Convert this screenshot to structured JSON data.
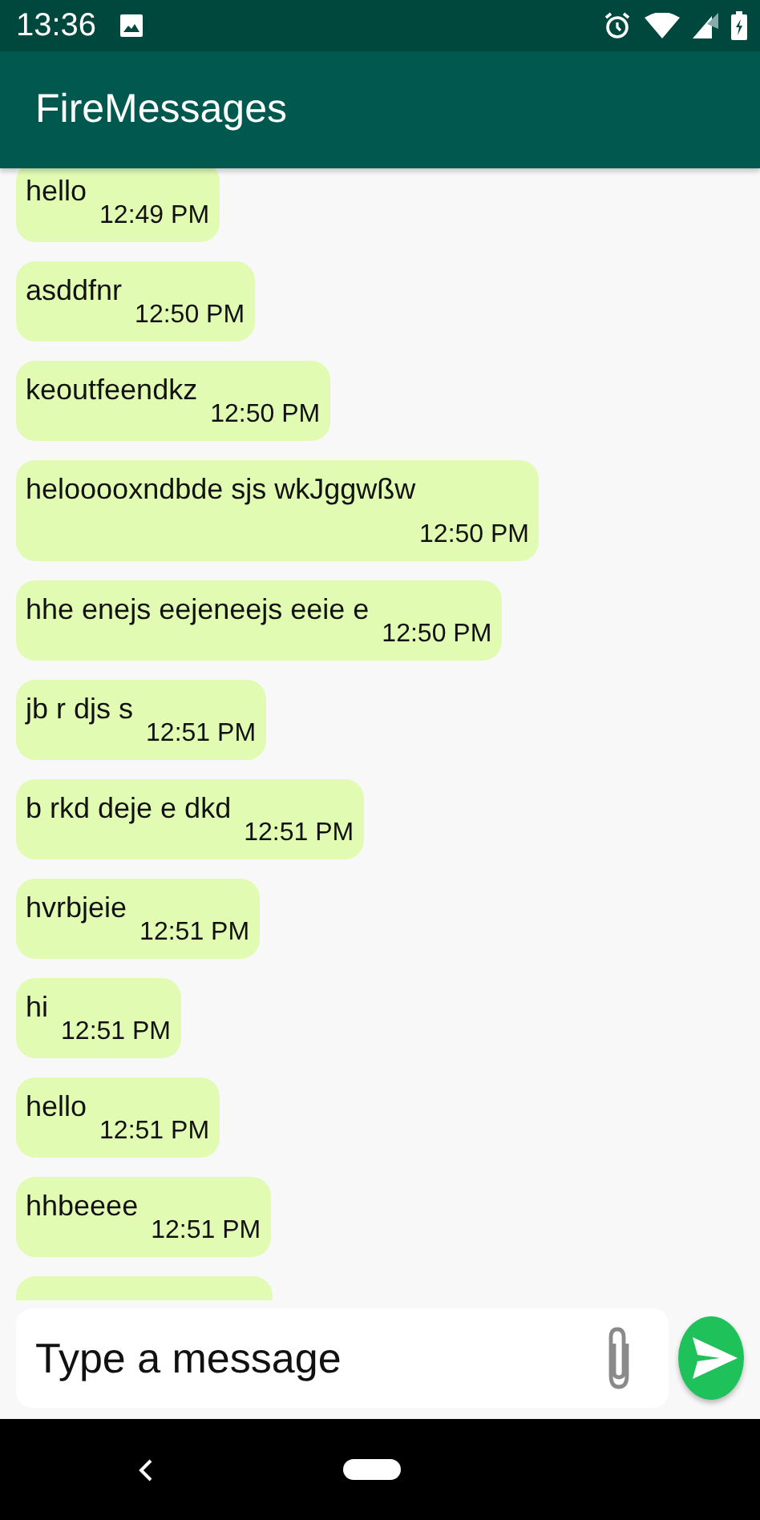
{
  "status_bar": {
    "time": "13:36"
  },
  "app_bar": {
    "title": "FireMessages"
  },
  "messages": [
    {
      "text": "hello",
      "time": "12:49 PM"
    },
    {
      "text": "asddfnr",
      "time": "12:50 PM"
    },
    {
      "text": "keoutfeendkz",
      "time": "12:50 PM"
    },
    {
      "text": "helooooxndbde sjs wkJggwßw",
      "time": "12:50 PM"
    },
    {
      "text": "hhe enejs eejeneejs eeie e",
      "time": "12:50 PM"
    },
    {
      "text": "jb r djs s",
      "time": "12:51 PM"
    },
    {
      "text": "b rkd deje e dkd",
      "time": "12:51 PM"
    },
    {
      "text": "hvrbjeie",
      "time": "12:51 PM"
    },
    {
      "text": "hi",
      "time": "12:51 PM"
    },
    {
      "text": "hello",
      "time": "12:51 PM"
    },
    {
      "text": "hhbeeee",
      "time": "12:51 PM"
    }
  ],
  "composer": {
    "placeholder": "Type a message"
  }
}
